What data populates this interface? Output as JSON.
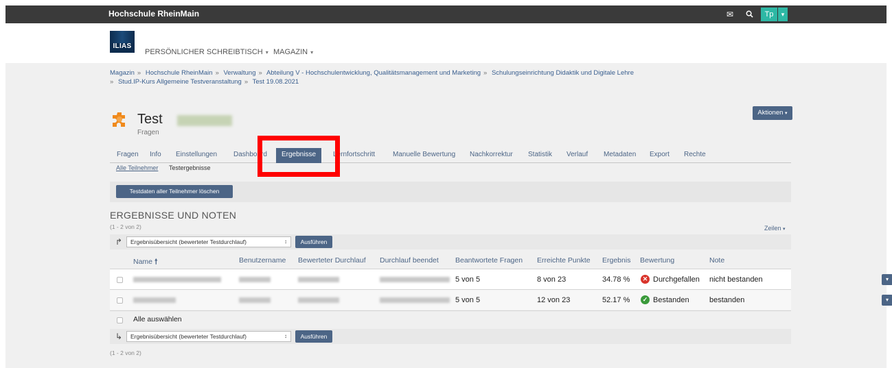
{
  "topbar": {
    "brand": "Hochschule RheinMain",
    "icons": [
      "mail-icon",
      "search-icon"
    ],
    "avatar_initials": "Tp"
  },
  "header": {
    "logo_text": "ILIAS",
    "nav": [
      {
        "label": "PERSÖNLICHER SCHREIBTISCH"
      },
      {
        "label": "MAGAZIN"
      }
    ]
  },
  "breadcrumb": {
    "items": [
      "Magazin",
      "Hochschule RheinMain",
      "Verwaltung",
      "Abteilung V - Hochschulentwicklung, Qualitätsmanagement und Marketing",
      "Schulungseinrichtung Didaktik und Digitale Lehre",
      "Stud.IP-Kurs Allgemeine Testveranstaltung",
      "Test 19.08.2021"
    ]
  },
  "page": {
    "title": "Test",
    "title_blurred": "19.08.2021",
    "subtitle": "Fragen",
    "actions_label": "Aktionen"
  },
  "tabs": [
    {
      "label": "Fragen"
    },
    {
      "label": "Info"
    },
    {
      "label": "Einstellungen"
    },
    {
      "label": "Dashboard"
    },
    {
      "label": "Ergebnisse",
      "active": true
    },
    {
      "label": "Lernfortschritt"
    },
    {
      "label": "Manuelle Bewertung"
    },
    {
      "label": "Nachkorrektur"
    },
    {
      "label": "Statistik"
    },
    {
      "label": "Verlauf"
    },
    {
      "label": "Metadaten"
    },
    {
      "label": "Export"
    },
    {
      "label": "Rechte"
    }
  ],
  "subtabs": [
    {
      "label": "Alle Teilnehmer",
      "active": true
    },
    {
      "label": "Testergebnisse"
    }
  ],
  "toolbar": {
    "delete_label": "Testdaten aller Teilnehmer löschen"
  },
  "results": {
    "section_title": "ERGEBNISSE UND NOTEN",
    "count_top": "(1 - 2 von 2)",
    "count_bottom": "(1 - 2 von 2)",
    "rows_label": "Zeilen",
    "command_select": "Ergebnisübersicht (bewerteter Testdurchlauf)",
    "execute_label": "Ausführen",
    "columns": [
      "Name",
      "Benutzername",
      "Bewerteter Durchlauf",
      "Durchlauf beendet",
      "Beantwortete Fragen",
      "Erreichte Punkte",
      "Ergebnis",
      "Bewertung",
      "Note"
    ],
    "rows": [
      {
        "answered": "5 von 5",
        "points": "8 von 23",
        "result": "34.78 %",
        "rating": "Durchgefallen",
        "rating_status": "failed",
        "grade": "nicht bestanden"
      },
      {
        "answered": "5 von 5",
        "points": "12 von 23",
        "result": "52.17 %",
        "rating": "Bestanden",
        "rating_status": "passed",
        "grade": "bestanden"
      }
    ],
    "select_all_label": "Alle auswählen"
  },
  "colors": {
    "accent": "#4c6586",
    "topbar": "#3a3a3a",
    "failed": "#d9342b",
    "passed": "#3a9a3a",
    "highlight": "#ff0000"
  }
}
